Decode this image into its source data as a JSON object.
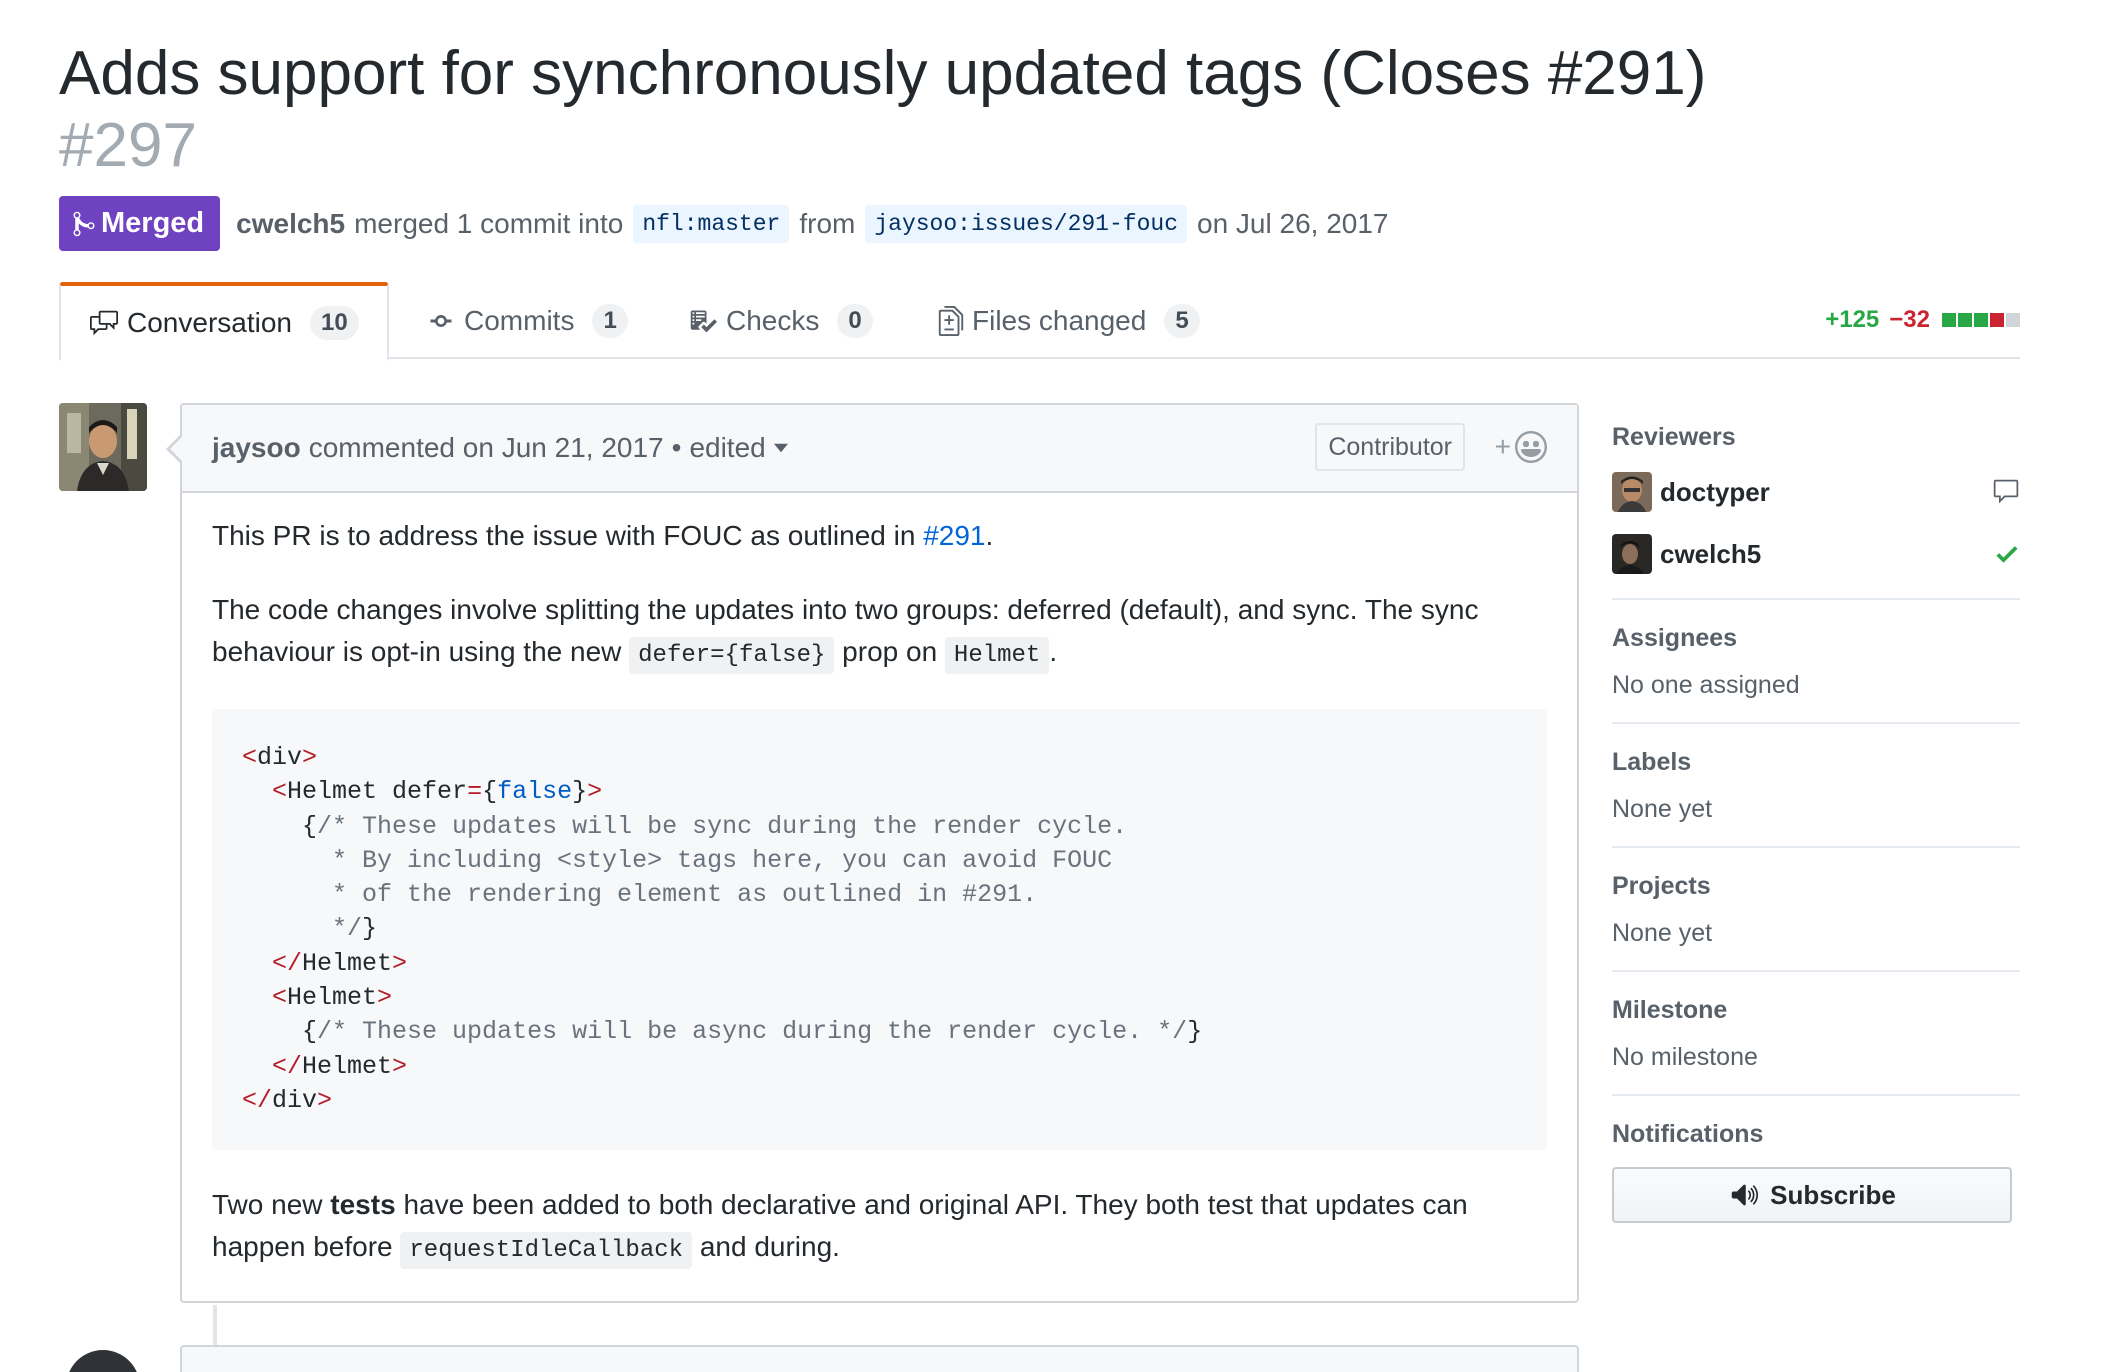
{
  "pr": {
    "title": "Adds support for synchronously updated tags (Closes #291)",
    "number": "#297",
    "state": "Merged",
    "author": "cwelch5",
    "action_text": "merged 1 commit into",
    "base_branch": "nfl:master",
    "from_text": "from",
    "head_branch": "jaysoo:issues/291-fouc",
    "date_text": "on Jul 26, 2017"
  },
  "tabs": [
    {
      "label": "Conversation",
      "count": "10",
      "icon": "comment-discussion-icon",
      "selected": true
    },
    {
      "label": "Commits",
      "count": "1",
      "icon": "git-commit-icon"
    },
    {
      "label": "Checks",
      "count": "0",
      "icon": "checklist-icon"
    },
    {
      "label": "Files changed",
      "count": "5",
      "icon": "file-diff-icon"
    }
  ],
  "diffstat": {
    "additions": "+125",
    "deletions": "−32",
    "blocks": [
      "#28a745",
      "#28a745",
      "#28a745",
      "#cb2431",
      "#d1d5da"
    ]
  },
  "comment": {
    "author": "jaysoo",
    "header_text": "commented on Jun 21, 2017",
    "bullet": "•",
    "edited_label": "edited",
    "role_badge": "Contributor",
    "reaction_plus": "+",
    "p1_before": "This PR is to address the issue with FOUC as outlined in",
    "p1_link": "#291",
    "p1_after": ".",
    "p2_text": "The code changes involve splitting the updates into two groups: deferred (default), and sync. The sync behaviour is opt-in using the new",
    "p2_code1": "defer={false}",
    "p2_mid": "prop on",
    "p2_code2": "Helmet",
    "p2_end": ".",
    "code": {
      "l1_open": "<",
      "l1_tag": "div",
      "l1_close": ">",
      "l2_open": "<",
      "l2_tag": "Helmet",
      "l2_attr": " defer",
      "l2_eq": "=",
      "l2_brace_open": "{",
      "l2_val": "false",
      "l2_brace_close": "}",
      "l2_close": ">",
      "l3_brace": "{",
      "l3_comment": "/* These updates will be sync during the render cycle.",
      "l4_comment": "* By including <style> tags here, you can avoid FOUC",
      "l5_comment": "* of the rendering element as outlined in #291.",
      "l6_comment": "*/",
      "l6_brace": "}",
      "l7_open": "</",
      "l7_tag": "Helmet",
      "l7_close": ">",
      "l8_open": "<",
      "l8_tag": "Helmet",
      "l8_close": ">",
      "l9_brace": "{",
      "l9_comment": "/* These updates will be async during the render cycle. */",
      "l9_brace_close": "}",
      "l10_open": "</",
      "l10_tag": "Helmet",
      "l10_close": ">",
      "l11_open": "</",
      "l11_tag": "div",
      "l11_close": ">"
    },
    "p3_before": "Two new",
    "p3_bold": "tests",
    "p3_mid": "have been added to both declarative and original API. They both test that updates can happen before",
    "p3_code": "requestIdleCallback",
    "p3_end": "and during."
  },
  "sidebar": {
    "reviewers_heading": "Reviewers",
    "reviewers": [
      {
        "name": "doctyper",
        "status_icon": "comment-icon"
      },
      {
        "name": "cwelch5",
        "status_icon": "check-icon"
      }
    ],
    "assignees_heading": "Assignees",
    "assignees_text": "No one assigned",
    "labels_heading": "Labels",
    "labels_text": "None yet",
    "projects_heading": "Projects",
    "projects_text": "None yet",
    "milestone_heading": "Milestone",
    "milestone_text": "No milestone",
    "notifications_heading": "Notifications",
    "subscribe_label": "Subscribe"
  }
}
